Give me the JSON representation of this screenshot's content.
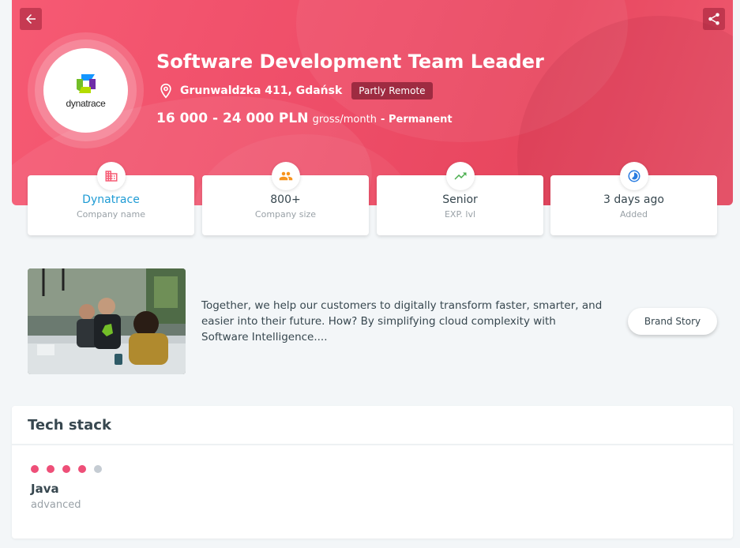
{
  "job": {
    "title": "Software Development Team Leader",
    "address": "Grunwaldzka 411, Gdańsk",
    "remote_badge": "Partly Remote",
    "salary": "16 000 - 24 000 PLN",
    "salary_unit": "gross/month",
    "employment_type": "- Permanent"
  },
  "company": {
    "logo_text": "dynatrace"
  },
  "stats": [
    {
      "value": "Dynatrace",
      "label": "Company name",
      "icon": "company-building-icon",
      "color": "#f65a73"
    },
    {
      "value": "800+",
      "label": "Company size",
      "icon": "people-icon",
      "color": "#f7941d"
    },
    {
      "value": "Senior",
      "label": "EXP. lvl",
      "icon": "trending-up-icon",
      "color": "#4caf50"
    },
    {
      "value": "3 days ago",
      "label": "Added",
      "icon": "clock-icon",
      "color": "#2a7de1"
    }
  ],
  "brand": {
    "description": "Together, we help our customers to digitally transform faster, smarter, and easier into their future. How? By simplifying cloud complexity with Software Intelligence....",
    "button_label": "Brand Story"
  },
  "tech_stack": {
    "title": "Tech stack",
    "skills": [
      {
        "name": "Java",
        "level": "advanced",
        "rating": 4,
        "max": 5
      }
    ]
  },
  "colors": {
    "accent": "#f65a73",
    "dot_filled": "#ee4f78",
    "dot_empty": "#c5ccd3",
    "link": "#1e9bd4"
  }
}
